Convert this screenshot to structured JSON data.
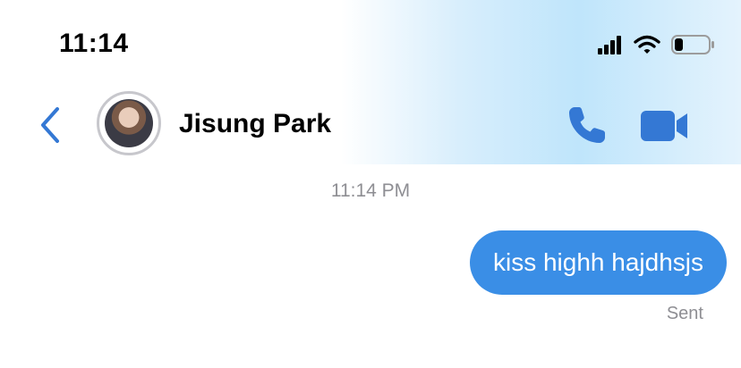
{
  "status_bar": {
    "time": "11:14",
    "signal_icon": "cellular-signal-icon",
    "wifi_icon": "wifi-icon",
    "battery_icon": "battery-icon",
    "battery_level": 0.25
  },
  "header": {
    "back_icon": "chevron-left-icon",
    "contact_name": "Jisung Park",
    "call_icon": "phone-icon",
    "video_icon": "video-camera-icon"
  },
  "conversation": {
    "timestamp": "11:14 PM",
    "messages": [
      {
        "text": "kiss highh hajdhsjs",
        "direction": "outgoing",
        "status": "Sent"
      }
    ]
  },
  "colors": {
    "accent": "#3478d4",
    "bubble": "#3a8ee6",
    "meta_text": "#8e8e93"
  }
}
